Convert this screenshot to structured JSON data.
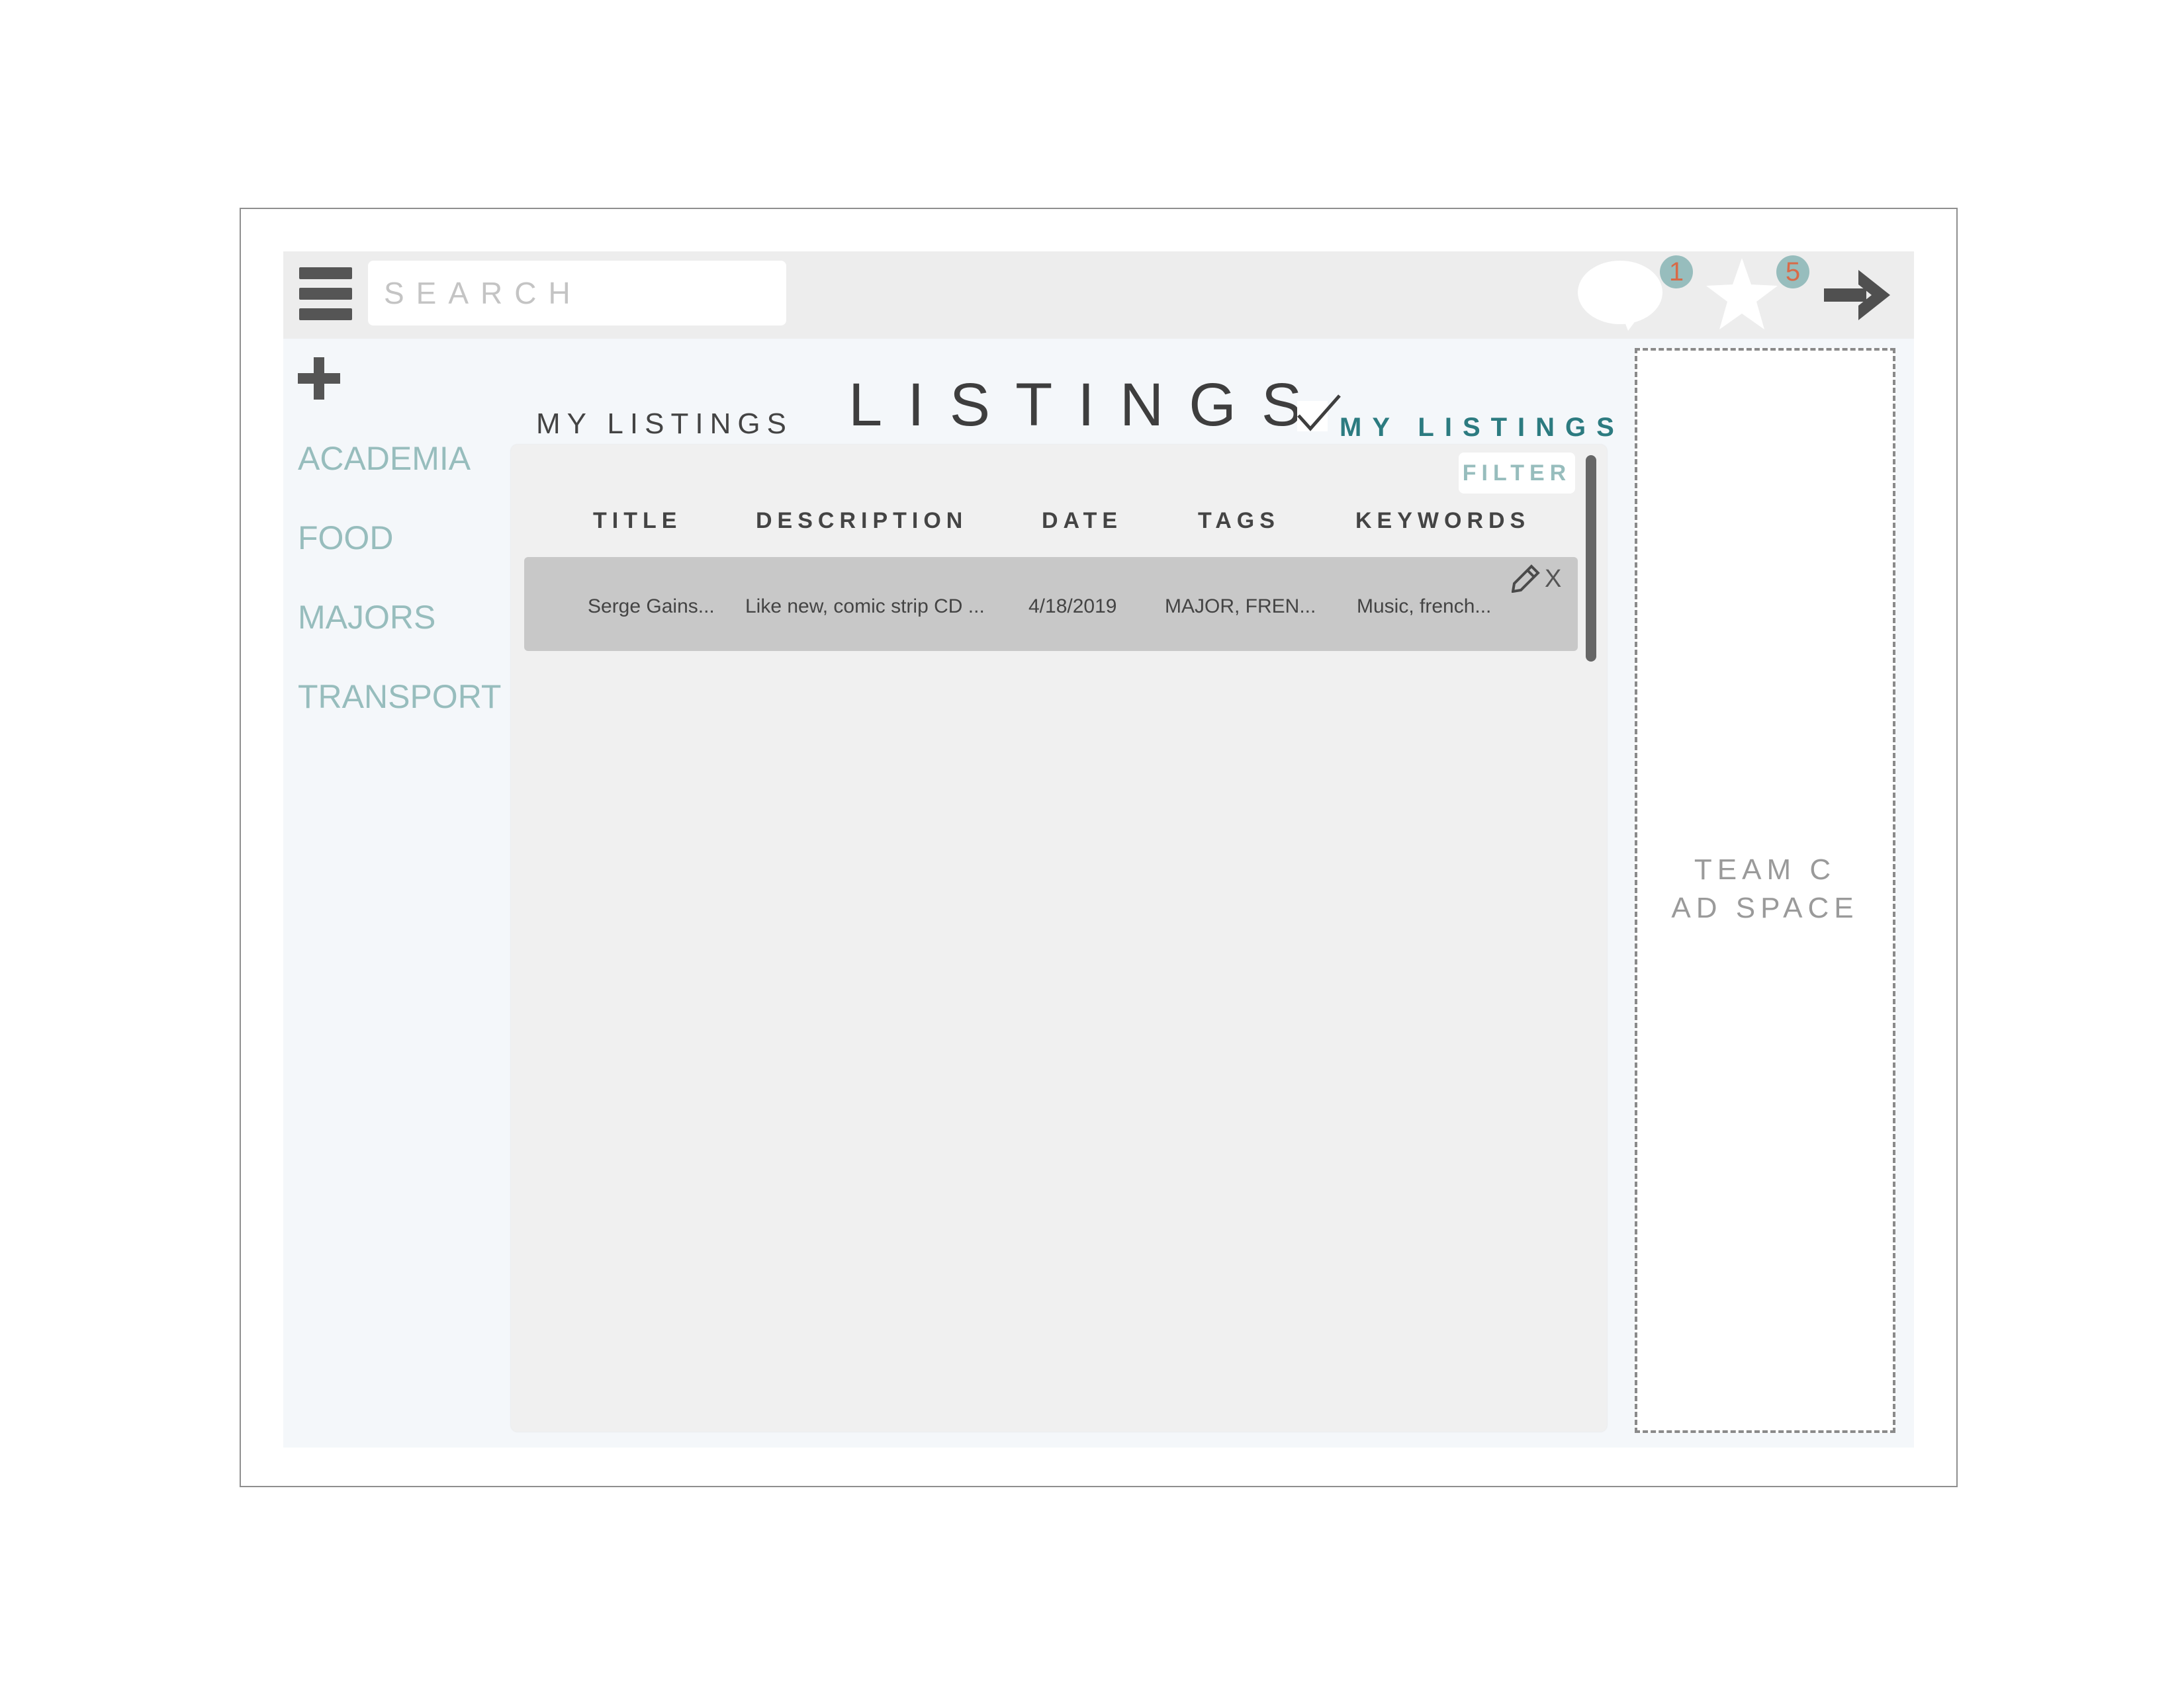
{
  "search": {
    "placeholder": "SEARCH"
  },
  "header": {
    "messages_count": "1",
    "favorites_count": "5",
    "badge_color": "#97bdbd",
    "badge_text_color": "#d86a48"
  },
  "sidebar": {
    "categories": [
      "ACADEMIA",
      "FOOD",
      "MAJORS",
      "TRANSPORT"
    ]
  },
  "main": {
    "left_heading": "MY LISTINGS",
    "title": "LISTINGS",
    "toggle_label": "MY LISTINGS",
    "toggle_checked": true,
    "filter_label": "FILTER",
    "columns": [
      "TITLE",
      "DESCRIPTION",
      "DATE",
      "TAGS",
      "KEYWORDS"
    ],
    "rows": [
      {
        "title": "Serge Gains...",
        "description": "Like new, comic strip CD ...",
        "date": "4/18/2019",
        "tags": "MAJOR, FREN...",
        "keywords": "Music, french...",
        "delete_label": "X"
      }
    ]
  },
  "ad": {
    "line1": "TEAM C",
    "line2": "AD SPACE"
  },
  "icons": [
    "menu-icon",
    "chat-bubble-icon",
    "star-icon",
    "arrow-right-icon",
    "plus-icon",
    "check-icon",
    "pencil-icon"
  ]
}
